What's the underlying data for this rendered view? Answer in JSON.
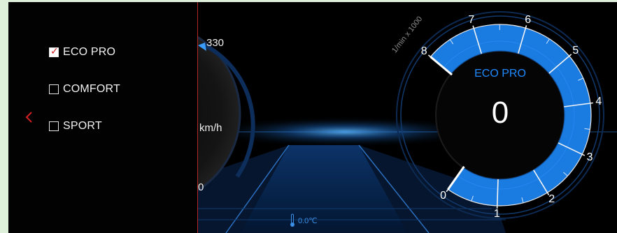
{
  "menu": {
    "back_icon": "chevron-left-icon",
    "modes": [
      {
        "label": "ECO PRO",
        "checked": true
      },
      {
        "label": "COMFORT",
        "checked": false
      },
      {
        "label": "SPORT",
        "checked": false
      }
    ]
  },
  "speedometer": {
    "max_label": "330",
    "min_label": "0",
    "unit": "km/h"
  },
  "tachometer": {
    "unit": "1/min x 1000",
    "mode": "ECO PRO",
    "value": "0",
    "ticks": [
      "0",
      "1",
      "2",
      "3",
      "4",
      "5",
      "6",
      "7",
      "8"
    ]
  },
  "status": {
    "temperature": "0.0℃",
    "temperature_icon": "thermometer-icon"
  },
  "colors": {
    "accent": "#1f8bff",
    "check": "#d32020",
    "divider": "#b32626"
  }
}
